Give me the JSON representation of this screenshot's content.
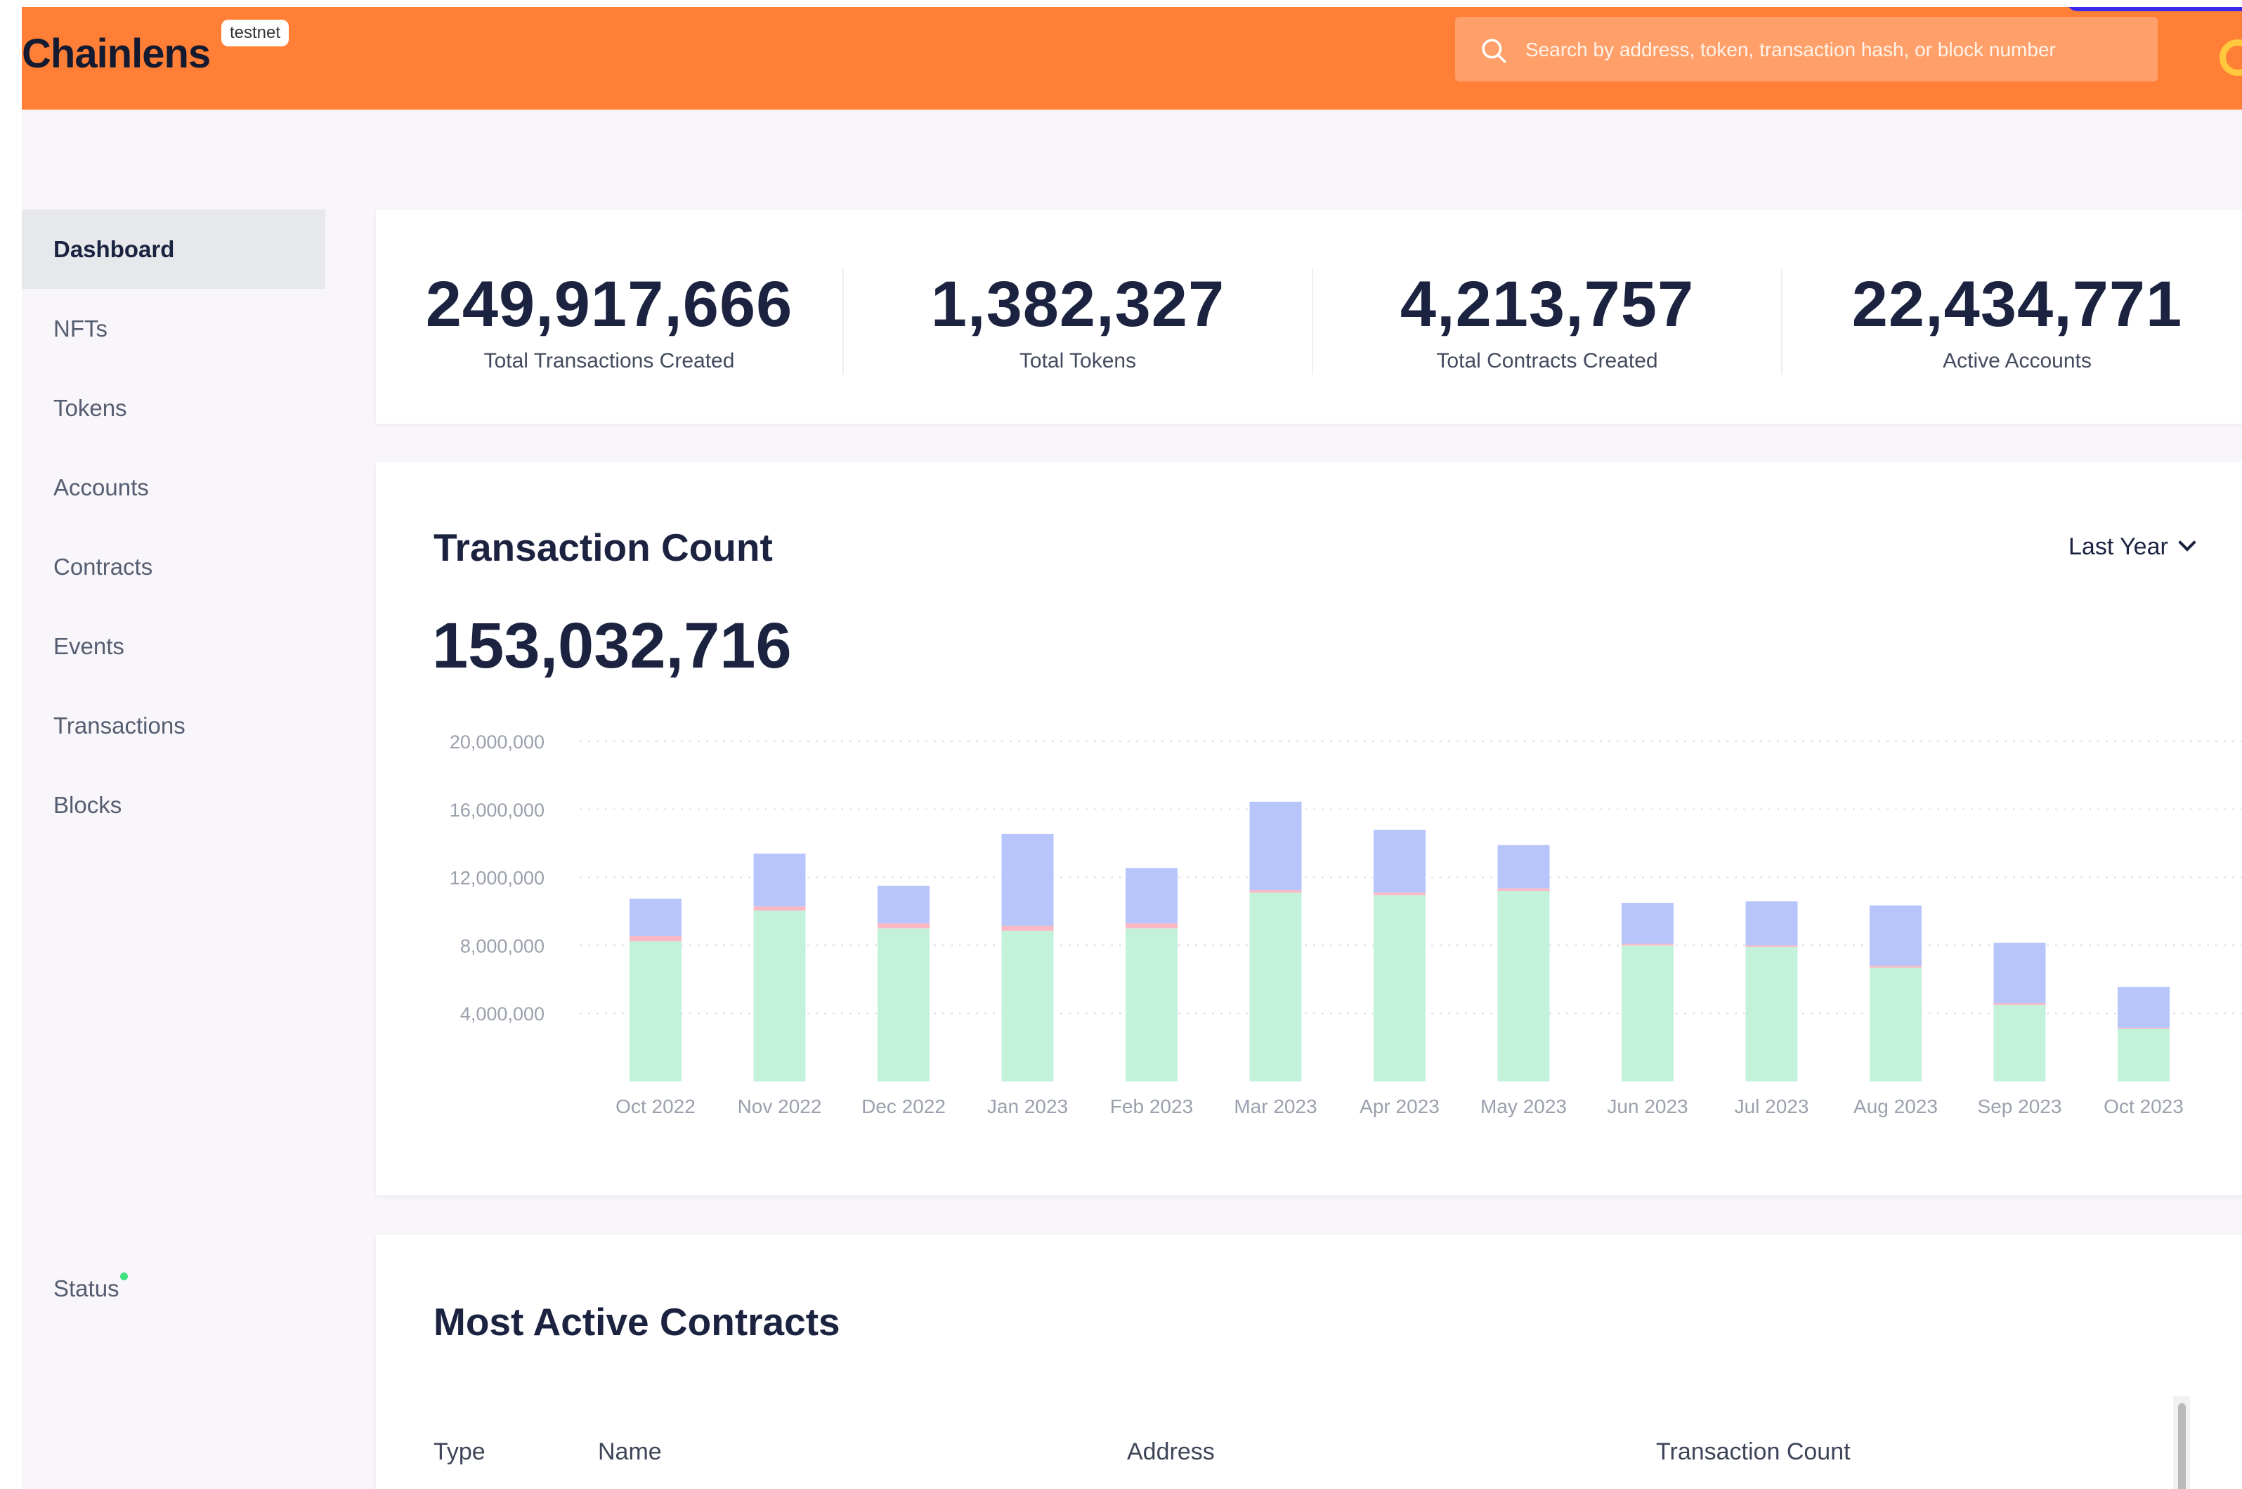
{
  "header": {
    "logo_text": "Chainlens",
    "env_badge": "testnet",
    "search_placeholder": "Search by address, token, transaction hash, or block number",
    "search_icon": "search-icon"
  },
  "sidebar": {
    "items": [
      {
        "label": "Dashboard",
        "active": true
      },
      {
        "label": "NFTs",
        "active": false
      },
      {
        "label": "Tokens",
        "active": false
      },
      {
        "label": "Accounts",
        "active": false
      },
      {
        "label": "Contracts",
        "active": false
      },
      {
        "label": "Events",
        "active": false
      },
      {
        "label": "Transactions",
        "active": false
      },
      {
        "label": "Blocks",
        "active": false
      }
    ],
    "status_label": "Status",
    "status_color": "#3ee07f"
  },
  "stats": [
    {
      "value": "249,917,666",
      "label": "Total Transactions Created"
    },
    {
      "value": "1,382,327",
      "label": "Total Tokens"
    },
    {
      "value": "4,213,757",
      "label": "Total Contracts Created"
    },
    {
      "value": "22,434,771",
      "label": "Active Accounts"
    }
  ],
  "transaction_count": {
    "title": "Transaction Count",
    "range_label": "Last Year",
    "total": "153,032,716"
  },
  "chart_data": {
    "type": "bar",
    "stacked": true,
    "categories": [
      "Oct 2022",
      "Nov 2022",
      "Dec 2022",
      "Jan 2023",
      "Feb 2023",
      "Mar 2023",
      "Apr 2023",
      "May 2023",
      "Jun 2023",
      "Jul 2023",
      "Aug 2023",
      "Sep 2023",
      "Oct 2023"
    ],
    "series": [
      {
        "color": "#c3f2db",
        "values": [
          8250000,
          10050000,
          9000000,
          8850000,
          9000000,
          11100000,
          10950000,
          11200000,
          8000000,
          7900000,
          6700000,
          4500000,
          3100000
        ]
      },
      {
        "color": "#f9b8c4",
        "values": [
          300000,
          250000,
          300000,
          300000,
          300000,
          150000,
          150000,
          150000,
          100000,
          100000,
          100000,
          100000,
          50000
        ]
      },
      {
        "color": "#b7c5fb",
        "values": [
          2200000,
          3100000,
          2200000,
          5400000,
          3250000,
          5200000,
          3700000,
          2550000,
          2400000,
          2600000,
          3550000,
          3550000,
          2400000
        ]
      }
    ],
    "ylim": [
      0,
      20000000
    ],
    "yticks": [
      "4,000,000",
      "8,000,000",
      "12,000,000",
      "16,000,000",
      "20,000,000"
    ],
    "ytick_values": [
      4000000,
      8000000,
      12000000,
      16000000,
      20000000
    ],
    "grid": true,
    "title": "",
    "xlabel": "",
    "ylabel": ""
  },
  "contracts": {
    "title": "Most Active Contracts",
    "columns": [
      "Type",
      "Name",
      "Address",
      "Transaction Count"
    ]
  },
  "colors": {
    "brand": "#ff7f36",
    "text_dark": "#1b2340",
    "background": "#f8f6fa"
  }
}
